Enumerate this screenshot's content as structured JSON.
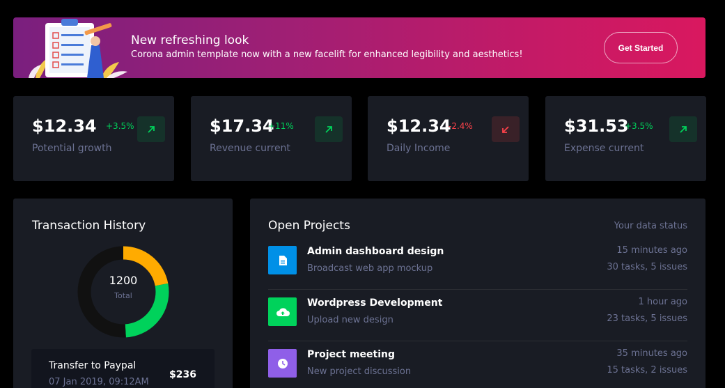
{
  "banner": {
    "title": "New refreshing look",
    "subtitle": "Corona admin template now with a new facelift for enhanced legibility and aesthetics!",
    "button_label": "Get Started"
  },
  "stats": [
    {
      "value": "$12.34",
      "change": "+3.5%",
      "trend": "up",
      "label": "Potential growth",
      "icon": "arrow-top-right-icon"
    },
    {
      "value": "$17.34",
      "change": "+11%",
      "trend": "up",
      "label": "Revenue current",
      "icon": "arrow-top-right-icon"
    },
    {
      "value": "$12.34",
      "change": "-2.4%",
      "trend": "down",
      "label": "Daily Income",
      "icon": "arrow-bottom-left-icon"
    },
    {
      "value": "$31.53",
      "change": "+3.5%",
      "trend": "up",
      "label": "Expense current",
      "icon": "arrow-top-right-icon"
    }
  ],
  "transaction_history": {
    "title": "Transaction History",
    "total": "1200",
    "total_label": "Total",
    "segments": [
      {
        "color": "#ffab00",
        "fraction": 0.22
      },
      {
        "color": "#00d25b",
        "fraction": 0.27
      },
      {
        "color": "#111111",
        "fraction": 0.51
      }
    ],
    "item": {
      "title": "Transfer to Paypal",
      "date": "07 Jan 2019, 09:12AM",
      "amount": "$236"
    }
  },
  "open_projects": {
    "title": "Open Projects",
    "status_label": "Your data status",
    "items": [
      {
        "name": "Admin dashboard design",
        "desc": "Broadcast web app mockup",
        "time": "15 minutes ago",
        "tasks": "30 tasks, 5 issues",
        "color": "#0090e7",
        "icon": "document-icon"
      },
      {
        "name": "Wordpress Development",
        "desc": "Upload new design",
        "time": "1 hour ago",
        "tasks": "23 tasks, 5 issues",
        "color": "#00d25b",
        "icon": "cloud-upload-icon"
      },
      {
        "name": "Project meeting",
        "desc": "New project discussion",
        "time": "35 minutes ago",
        "tasks": "15 tasks, 2 issues",
        "color": "#8f5fe8",
        "icon": "clock-icon"
      }
    ]
  },
  "colors": {
    "card_bg": "#191c24",
    "muted_text": "#6c7293",
    "success": "#00d25b",
    "danger": "#fc424a",
    "warning": "#ffab00"
  }
}
